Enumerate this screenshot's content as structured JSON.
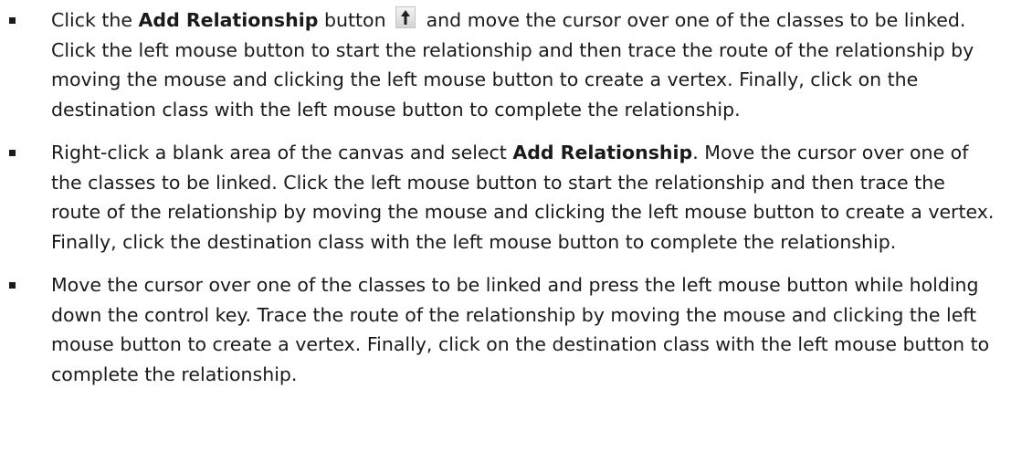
{
  "bullets": [
    {
      "parts": {
        "a": "Click the ",
        "b": "Add Relationship",
        "c": " button ",
        "d": " and move the cursor over one of the classes to be linked. Click the left mouse button to start the relationship and then trace the route of the relationship by moving the mouse and clicking the left mouse button to create a vertex. Finally, click on the destination class with the left mouse button to complete the relationship."
      },
      "icon": "add-relationship-arrow-icon"
    },
    {
      "parts": {
        "a": "Right-click a blank area of the canvas and select ",
        "b": "Add Relationship",
        "c": ". Move the cursor over one of the classes to be linked. Click the left mouse button to start the relationship and then trace the route of the relationship by moving the mouse and clicking the left mouse button to create a vertex. Finally, click the destination class with the left mouse button to complete the relationship."
      }
    },
    {
      "parts": {
        "a": "Move the cursor over one of the classes to be linked and press the left mouse button while holding down the control key. Trace the route of the relationship by moving the mouse and clicking the left mouse button to create a vertex. Finally, click on the destination class with the left mouse button to complete the relationship."
      }
    }
  ]
}
